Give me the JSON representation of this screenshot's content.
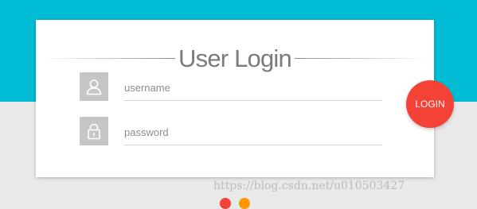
{
  "title": "User Login",
  "fields": {
    "username": {
      "value": "",
      "placeholder": "username",
      "icon": "user-icon"
    },
    "password": {
      "value": "",
      "placeholder": "password",
      "icon": "lock-icon"
    }
  },
  "login_button": {
    "label": "LOGIN",
    "color": "#f44336"
  },
  "colors": {
    "header_band": "#00bcd4",
    "background": "#e9e9e9",
    "card": "#ffffff",
    "icon_box": "#c6c6c6",
    "dot_left": "#f44336",
    "dot_right": "#ff9800"
  },
  "watermark": "https://blog.csdn.net/u010503427"
}
